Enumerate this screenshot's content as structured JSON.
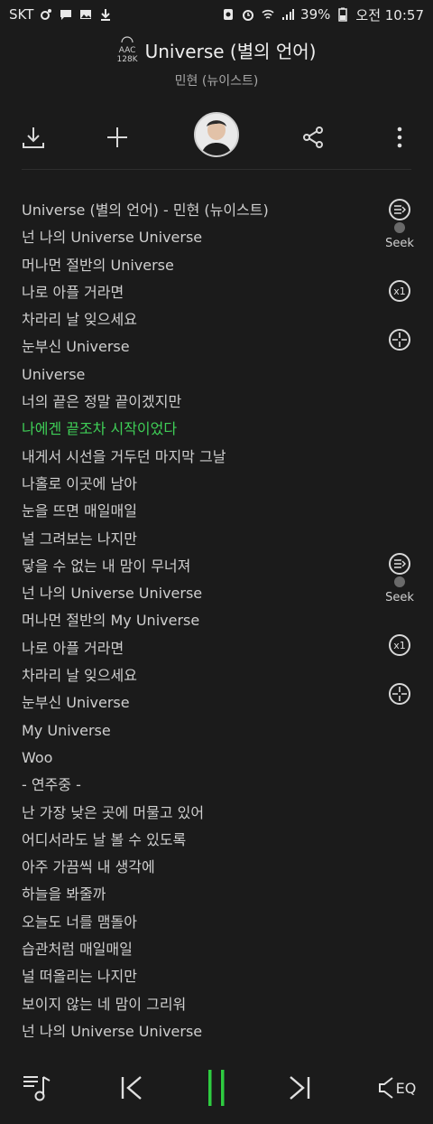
{
  "status_bar": {
    "carrier": "SKT",
    "battery": "39%",
    "time": "오전 10:57",
    "icons": [
      "swing-icon",
      "message-icon",
      "image-icon",
      "download-icon",
      "record-icon",
      "alarm-icon",
      "wifi-icon",
      "signal-icon",
      "battery-icon"
    ]
  },
  "header": {
    "badge_line1": "AAC",
    "badge_line2": "128K",
    "title": "Universe (별의 언어)",
    "artist": "민현 (뉴이스트)"
  },
  "toolbar": {
    "icons": [
      "download-icon",
      "add-icon",
      "avatar",
      "share-icon",
      "more-icon"
    ]
  },
  "lyrics": [
    "Universe (별의 언어) - 민현 (뉴이스트)",
    "넌 나의 Universe Universe",
    "머나먼 절반의 Universe",
    "나로 아플 거라면",
    "차라리 날 잊으세요",
    "눈부신 Universe",
    "Universe",
    "너의 끝은 정말 끝이겠지만",
    "나에겐 끝조차 시작이었다",
    "내게서 시선을 거두던 마지막 그날",
    "나홀로 이곳에 남아",
    "눈을 뜨면 매일매일",
    "널 그려보는 나지만",
    "닿을 수 없는 내 맘이 무너져",
    "넌 나의 Universe Universe",
    "머나먼 절반의 My Universe",
    "나로 아플 거라면",
    "차라리 날 잊으세요",
    "눈부신 Universe",
    "My Universe",
    "Woo",
    "- 연주중 -",
    "난 가장 낮은 곳에 머물고 있어",
    "어디서라도 날 볼 수 있도록",
    "아주 가끔씩 내 생각에",
    "하늘을 봐줄까",
    "오늘도 너를 맴돌아",
    "습관처럼 매일매일",
    "널 떠올리는 나지만",
    "보이지 않는 네 맘이 그리워",
    "넌 나의 Universe Universe"
  ],
  "active_lyric_index": 8,
  "side_controls": {
    "seek_label": "Seek",
    "speed_label": "x1"
  },
  "player": {
    "eq_label": "EQ",
    "accent_color": "#2ecc40"
  }
}
